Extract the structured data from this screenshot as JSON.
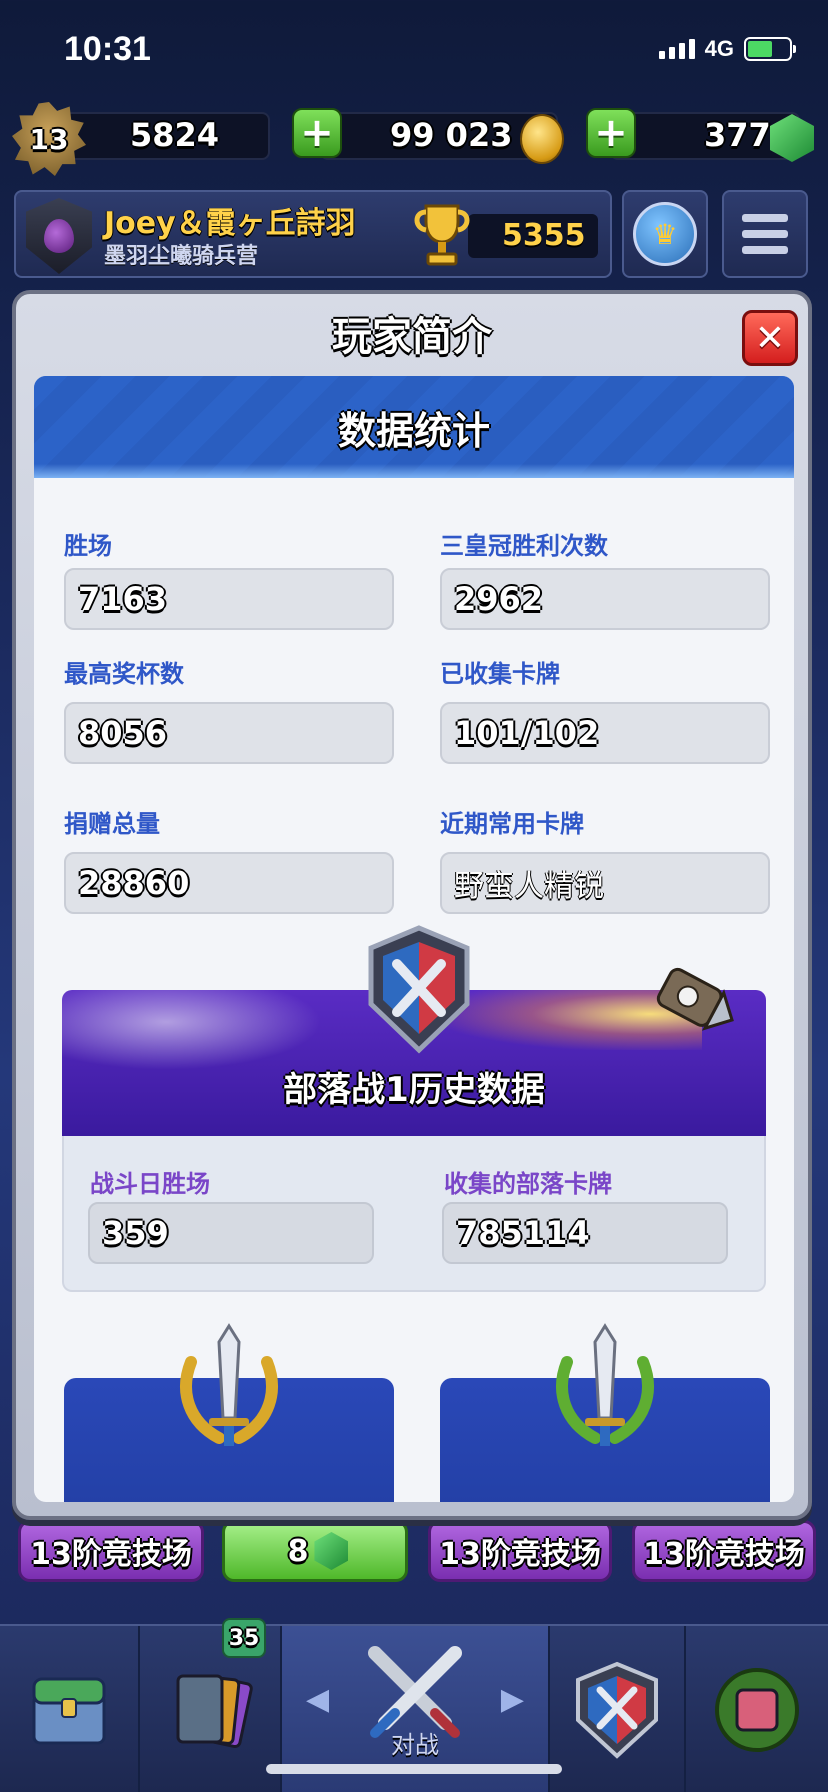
{
  "status_bar": {
    "time": "10:31",
    "network": "4G"
  },
  "resources": {
    "level": "13",
    "experience": "5824",
    "gold": "99 023",
    "gems": "377",
    "plus_label": "+"
  },
  "player_bar": {
    "player_name": "Joey＆霞ヶ丘詩羽",
    "clan_name": "墨羽尘曦骑兵营",
    "trophies": "5355"
  },
  "modal": {
    "title": "玩家简介",
    "close_label": "✕",
    "section_title": "数据统计",
    "stats": {
      "wins_label": "胜场",
      "wins": "7163",
      "three_crown_label": "三皇冠胜利次数",
      "three_crown": "2962",
      "best_trophies_label": "最高奖杯数",
      "best_trophies": "8056",
      "cards_found_label": "已收集卡牌",
      "cards_found": "101/102",
      "donations_label": "捐赠总量",
      "donations": "28860",
      "favorite_card_label": "近期常用卡牌",
      "favorite_card": "野蛮人精锐"
    },
    "clan_war": {
      "title": "部落战1历史数据",
      "war_day_wins_label": "战斗日胜场",
      "war_day_wins": "359",
      "clan_cards_collected_label": "收集的部落卡牌",
      "clan_cards_collected": "785114"
    }
  },
  "arena_row": {
    "left_label": "13阶竞技场",
    "gem_offer": "8",
    "mid_label": "13阶竞技场",
    "right_label": "13阶竞技场"
  },
  "nav": {
    "cards_badge": "35",
    "battle_label": "对战",
    "tabs": [
      "shop-icon",
      "cards-icon",
      "battle-icon",
      "clan-icon",
      "events-icon"
    ]
  },
  "colors": {
    "accent_blue": "#2f57c8",
    "war_purple": "#5a2cc4",
    "gold": "#ffd24a",
    "close_red": "#d41e1e",
    "plus_green": "#4fb82a"
  }
}
